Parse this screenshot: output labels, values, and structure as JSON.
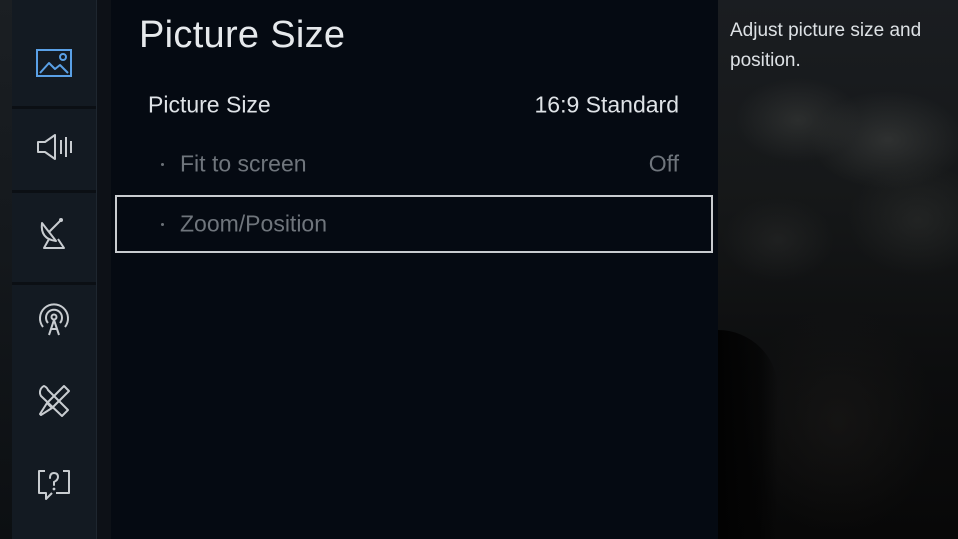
{
  "panel": {
    "title": "Picture Size"
  },
  "menu": {
    "picture_size": {
      "label": "Picture Size",
      "value": "16:9 Standard"
    },
    "fit_to_screen": {
      "label": "Fit to screen",
      "value": "Off"
    },
    "zoom_position": {
      "label": "Zoom/Position"
    }
  },
  "info": {
    "description": "Adjust picture size and position."
  },
  "side_icons": [
    "picture-icon",
    "sound-icon",
    "broadcasting-icon",
    "network-icon",
    "tools-icon",
    "support-icon"
  ],
  "colors": {
    "accent_icon": "#5aa0e6",
    "icon": "#c8ccd0",
    "focus_border": "#c9ccd0"
  }
}
